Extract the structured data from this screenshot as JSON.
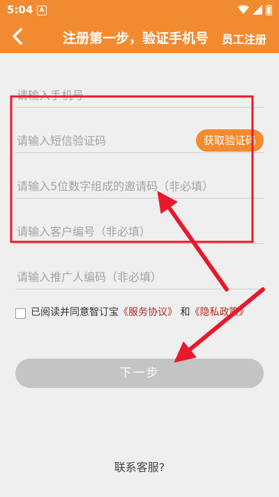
{
  "status_bar": {
    "time": "5:04",
    "notification_icon": "A"
  },
  "header": {
    "title": "注册第一步，验证手机号",
    "action": "员工注册"
  },
  "form": {
    "phone_placeholder": "请输入手机号",
    "sms_placeholder": "请输入短信验证码",
    "get_code_label": "获取验证码",
    "invite_placeholder": "请输入5位数字组成的邀请码（非必填）",
    "customer_placeholder": "请输入客户编号（非必填）",
    "referrer_placeholder": "请输入推广人编码（非必填）"
  },
  "agreement": {
    "prefix": "已阅读并同意智订宝",
    "service_link": "《服务协议》",
    "and": "和",
    "privacy_link": "《隐私政策》"
  },
  "next_label": "下一步",
  "support_label": "联系客服?",
  "colors": {
    "brand": "#f28b30",
    "annotation": "#e8192c",
    "link": "#b52a22",
    "disabled": "#c4c4c4"
  }
}
